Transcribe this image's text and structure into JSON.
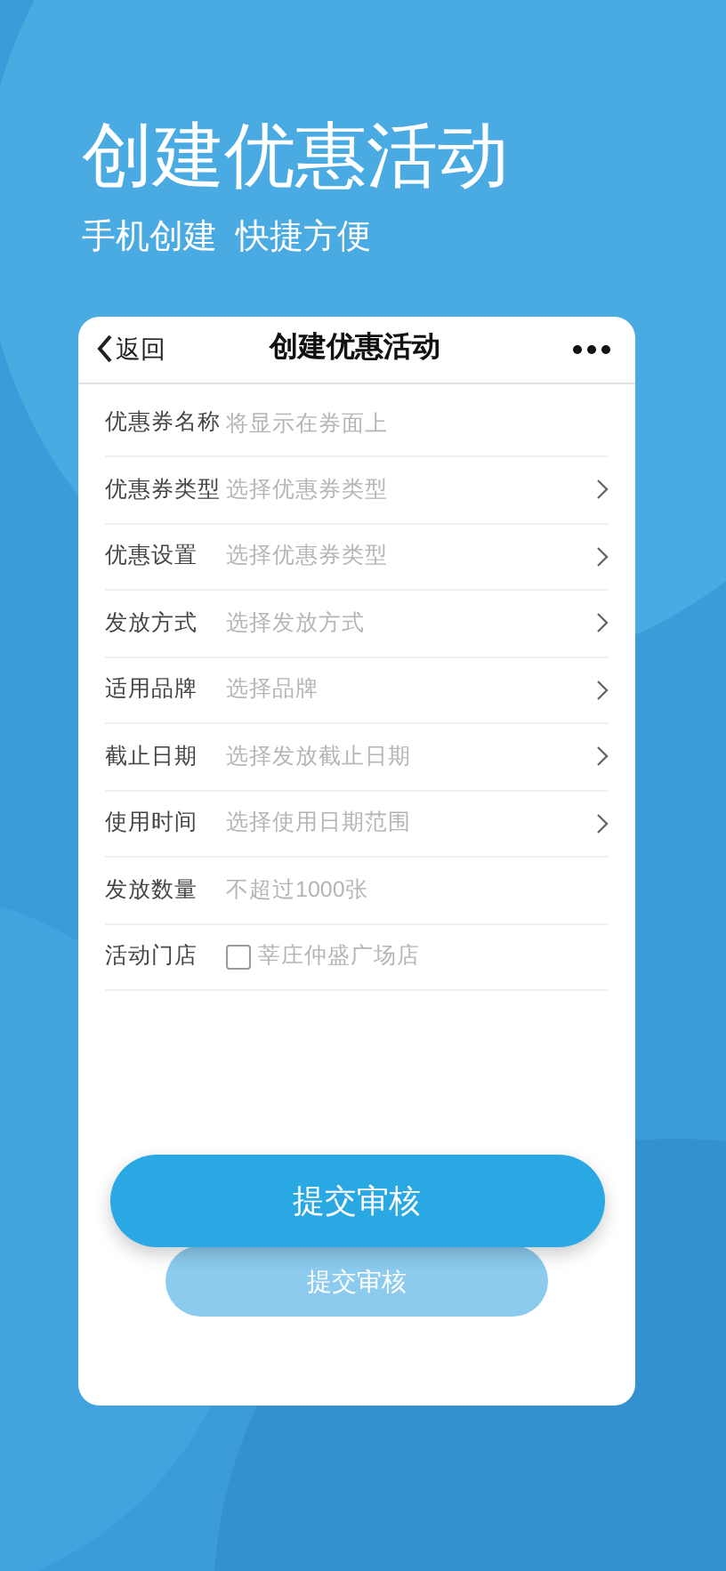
{
  "hero": {
    "title": "创建优惠活动",
    "subtitle": "手机创建  快捷方便"
  },
  "nav": {
    "back": "返回",
    "title": "创建优惠活动"
  },
  "form": [
    {
      "kind": "text",
      "label": "优惠券名称",
      "placeholder": "将显示在券面上"
    },
    {
      "kind": "select",
      "label": "优惠券类型",
      "placeholder": "选择优惠券类型"
    },
    {
      "kind": "select",
      "label": "优惠设置",
      "placeholder": "选择优惠券类型"
    },
    {
      "kind": "select",
      "label": "发放方式",
      "placeholder": "选择发放方式"
    },
    {
      "kind": "select",
      "label": "适用品牌",
      "placeholder": "选择品牌"
    },
    {
      "kind": "select",
      "label": "截止日期",
      "placeholder": "选择发放截止日期"
    },
    {
      "kind": "select",
      "label": "使用时间",
      "placeholder": "选择使用日期范围"
    },
    {
      "kind": "text",
      "label": "发放数量",
      "placeholder": "不超过1000张"
    },
    {
      "kind": "checkbox",
      "label": "活动门店",
      "option": "莘庄仲盛广场店",
      "checked": false
    }
  ],
  "buttons": [
    {
      "label": "提交审核",
      "disabled": false
    },
    {
      "label": "提交审核",
      "disabled": true
    }
  ]
}
